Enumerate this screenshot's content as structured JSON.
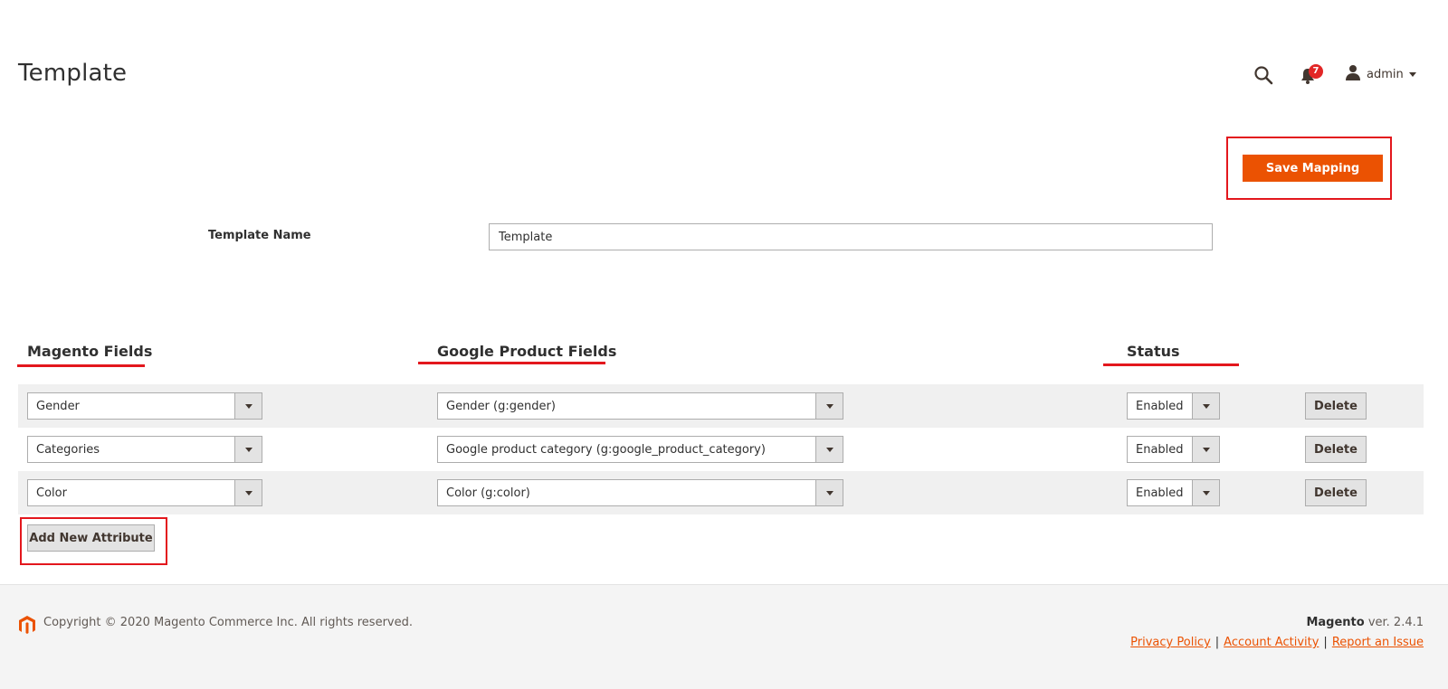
{
  "page": {
    "title": "Template"
  },
  "header": {
    "notification_count": "7",
    "user_name": "admin"
  },
  "actions": {
    "save_label": "Save Mapping"
  },
  "form": {
    "template_name_label": "Template Name",
    "template_name_value": "Template"
  },
  "columns": {
    "magento": "Magento Fields",
    "google": "Google Product Fields",
    "status": "Status"
  },
  "rows": [
    {
      "magento_field": "Gender",
      "google_field": "Gender (g:gender)",
      "status": "Enabled",
      "delete_label": "Delete"
    },
    {
      "magento_field": "Categories",
      "google_field": "Google product category (g:google_product_category)",
      "status": "Enabled",
      "delete_label": "Delete"
    },
    {
      "magento_field": "Color",
      "google_field": "Color (g:color)",
      "status": "Enabled",
      "delete_label": "Delete"
    }
  ],
  "add_attribute_label": "Add New Attribute",
  "footer": {
    "copyright": "Copyright © 2020 Magento Commerce Inc. All rights reserved.",
    "brand": "Magento",
    "version": "ver. 2.4.1",
    "links": [
      "Privacy Policy",
      "Account Activity",
      "Report an Issue"
    ],
    "separator": "|"
  },
  "colors": {
    "accent": "#eb5202",
    "highlight": "#e3171d",
    "badge": "#e22626"
  },
  "icons": {
    "search": "search-icon",
    "notifications": "bell-icon",
    "user": "user-icon",
    "logo": "magento-logo-icon"
  }
}
